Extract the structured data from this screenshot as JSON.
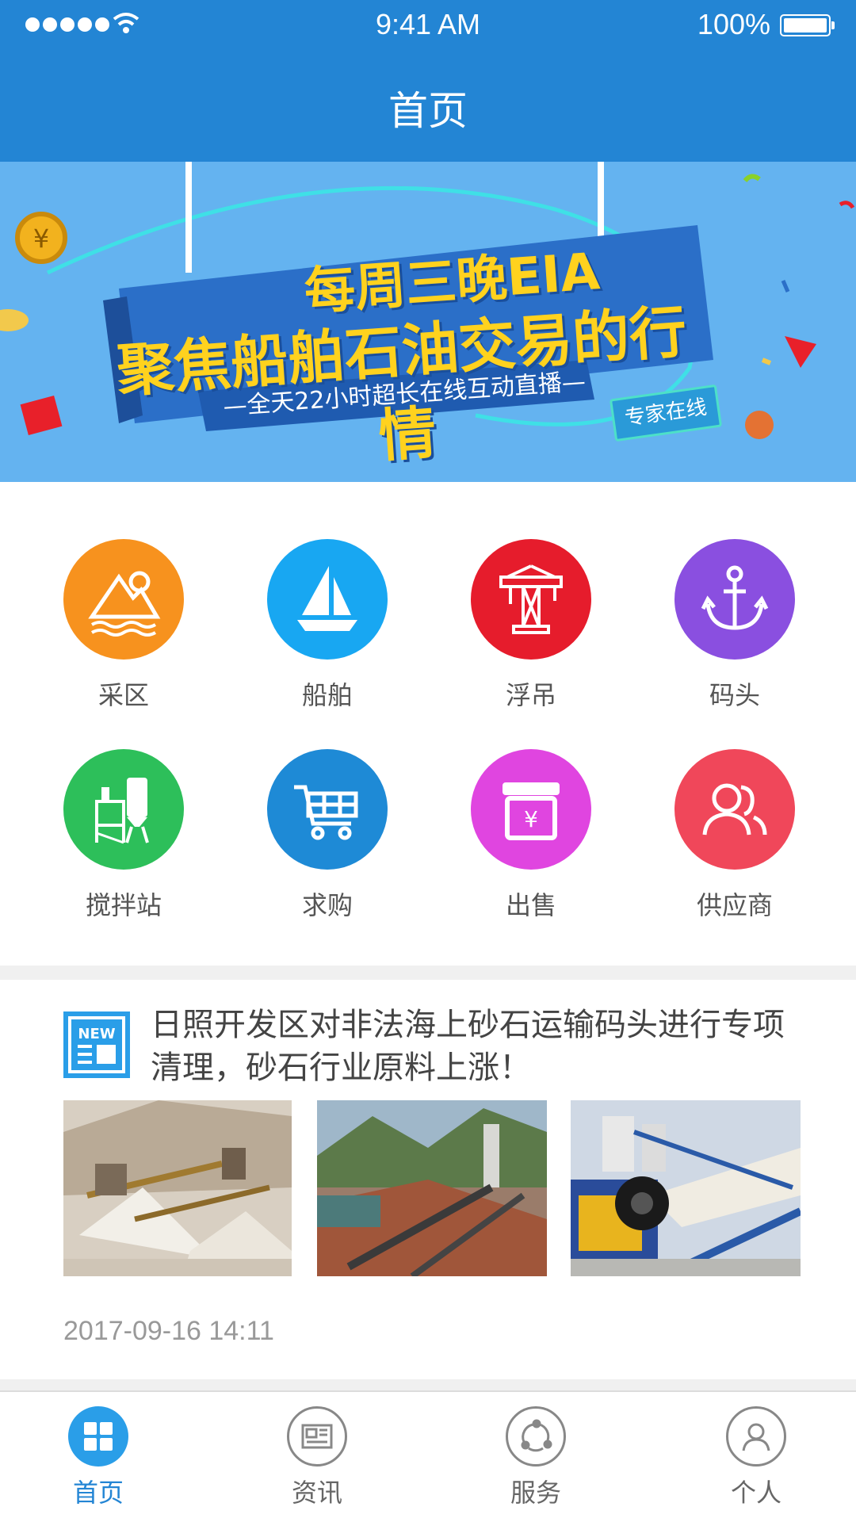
{
  "status_bar": {
    "time": "9:41 AM",
    "battery": "100%"
  },
  "header": {
    "title": "首页"
  },
  "banner": {
    "line1": "每周三晚EIA",
    "line2": "聚焦船舶石油交易的行情",
    "line3": "—全天22小时超长在线互动直播—",
    "badge": "专家在线",
    "page_count": 4,
    "active_page": 1
  },
  "categories": [
    {
      "label": "采区",
      "icon": "mountain-icon",
      "color": "#f7921e"
    },
    {
      "label": "船舶",
      "icon": "sailboat-icon",
      "color": "#18a7f2"
    },
    {
      "label": "浮吊",
      "icon": "crane-icon",
      "color": "#e61c2c"
    },
    {
      "label": "码头",
      "icon": "anchor-icon",
      "color": "#8a4fe0"
    },
    {
      "label": "搅拌站",
      "icon": "mixing-plant-icon",
      "color": "#2dbf5a"
    },
    {
      "label": "求购",
      "icon": "cart-icon",
      "color": "#1e8ad6"
    },
    {
      "label": "出售",
      "icon": "shop-icon",
      "color": "#e045e0"
    },
    {
      "label": "供应商",
      "icon": "supplier-icon",
      "color": "#f0475a"
    }
  ],
  "news": {
    "badge": "NEW",
    "title": "日照开发区对非法海上砂石运输码头进行专项清理，砂石行业原料上涨！",
    "date": "2017-09-16   14:11"
  },
  "tabs": [
    {
      "label": "首页",
      "icon": "home-grid-icon",
      "active": true
    },
    {
      "label": "资讯",
      "icon": "news-icon",
      "active": false
    },
    {
      "label": "服务",
      "icon": "service-icon",
      "active": false
    },
    {
      "label": "个人",
      "icon": "person-icon",
      "active": false
    }
  ]
}
